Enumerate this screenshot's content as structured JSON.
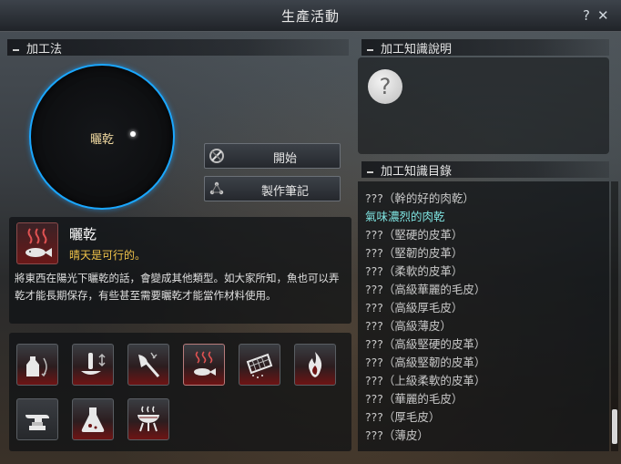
{
  "window": {
    "title": "生產活動",
    "help_label": "?",
    "close_label": "✕"
  },
  "craft_section": {
    "header": "加工法",
    "circle_label": "曬乾"
  },
  "buttons": {
    "start_label": "開始",
    "notes_label": "製作筆記"
  },
  "selected_method": {
    "name": "曬乾",
    "condition": "晴天是可行的。",
    "description": "將東西在陽光下曬乾的話，會變成其他類型。如大家所知，魚也可以弄乾才能長期保存，有些甚至需要曬乾才能當作材料使用。",
    "icon": "fish-heat-icon"
  },
  "tools": [
    {
      "icon": "shake-bottle-icon",
      "style": "red"
    },
    {
      "icon": "grind-icon",
      "style": "red"
    },
    {
      "icon": "chop-icon",
      "style": "red"
    },
    {
      "icon": "dry-fish-icon",
      "style": "red",
      "selected": true
    },
    {
      "icon": "sieve-icon",
      "style": "red"
    },
    {
      "icon": "fire-icon",
      "style": "red"
    },
    {
      "icon": "anvil-icon",
      "style": "dark"
    },
    {
      "icon": "flask-icon",
      "style": "red"
    },
    {
      "icon": "grill-icon",
      "style": "red"
    }
  ],
  "knowledge_section": {
    "header": "加工知識說明",
    "placeholder_icon": "?"
  },
  "knowledge_list": {
    "header": "加工知識目錄",
    "items": [
      {
        "label": "???（幹的好的肉乾）",
        "active": false
      },
      {
        "label": "氣味濃烈的肉乾",
        "active": true
      },
      {
        "label": "???（堅硬的皮革）",
        "active": false
      },
      {
        "label": "???（堅韌的皮革）",
        "active": false
      },
      {
        "label": "???（柔軟的皮革）",
        "active": false
      },
      {
        "label": "???（高級華麗的毛皮）",
        "active": false
      },
      {
        "label": "???（高級厚毛皮）",
        "active": false
      },
      {
        "label": "???（高級薄皮）",
        "active": false
      },
      {
        "label": "???（高級堅硬的皮革）",
        "active": false
      },
      {
        "label": "???（高級堅韌的皮革）",
        "active": false
      },
      {
        "label": "???（上級柔軟的皮革）",
        "active": false
      },
      {
        "label": "???（華麗的毛皮）",
        "active": false
      },
      {
        "label": "???（厚毛皮）",
        "active": false
      },
      {
        "label": "???（薄皮）",
        "active": false
      }
    ]
  },
  "colors": {
    "accent_blue": "#1aa7ff",
    "highlight_cyan": "#7ee3e0",
    "condition_yellow": "#f0c34a",
    "circle_label": "#f0d9a0"
  }
}
